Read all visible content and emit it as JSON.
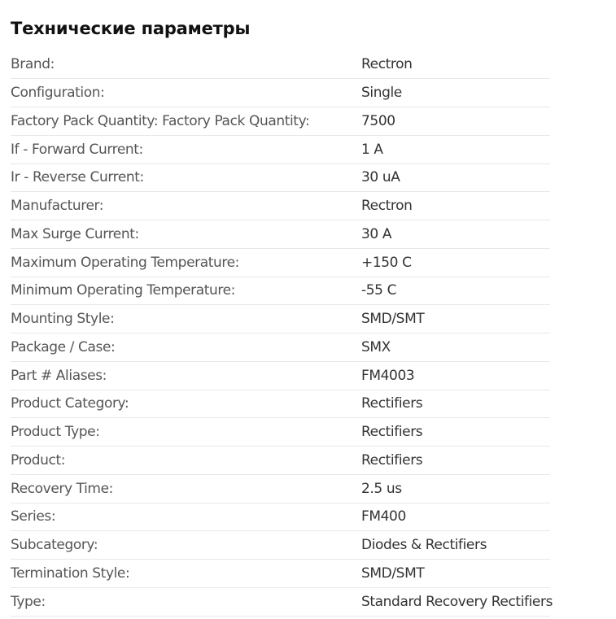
{
  "section": {
    "title": "Технические параметры"
  },
  "specs": [
    {
      "label": "Brand:",
      "value": "Rectron"
    },
    {
      "label": "Configuration:",
      "value": "Single"
    },
    {
      "label": "Factory Pack Quantity: Factory Pack Quantity:",
      "value": "7500"
    },
    {
      "label": "If - Forward Current:",
      "value": "1 A"
    },
    {
      "label": "Ir - Reverse Current:",
      "value": "30 uA"
    },
    {
      "label": "Manufacturer:",
      "value": "Rectron"
    },
    {
      "label": "Max Surge Current:",
      "value": "30 A"
    },
    {
      "label": "Maximum Operating Temperature:",
      "value": "+150 C"
    },
    {
      "label": "Minimum Operating Temperature:",
      "value": "-55 C"
    },
    {
      "label": "Mounting Style:",
      "value": "SMD/SMT"
    },
    {
      "label": "Package / Case:",
      "value": "SMX"
    },
    {
      "label": "Part # Aliases:",
      "value": "FM4003"
    },
    {
      "label": "Product Category:",
      "value": "Rectifiers"
    },
    {
      "label": "Product Type:",
      "value": "Rectifiers"
    },
    {
      "label": "Product:",
      "value": "Rectifiers"
    },
    {
      "label": "Recovery Time:",
      "value": "2.5 us"
    },
    {
      "label": "Series:",
      "value": "FM400"
    },
    {
      "label": "Subcategory:",
      "value": "Diodes & Rectifiers"
    },
    {
      "label": "Termination Style:",
      "value": "SMD/SMT"
    },
    {
      "label": "Type:",
      "value": "Standard Recovery Rectifiers"
    }
  ]
}
